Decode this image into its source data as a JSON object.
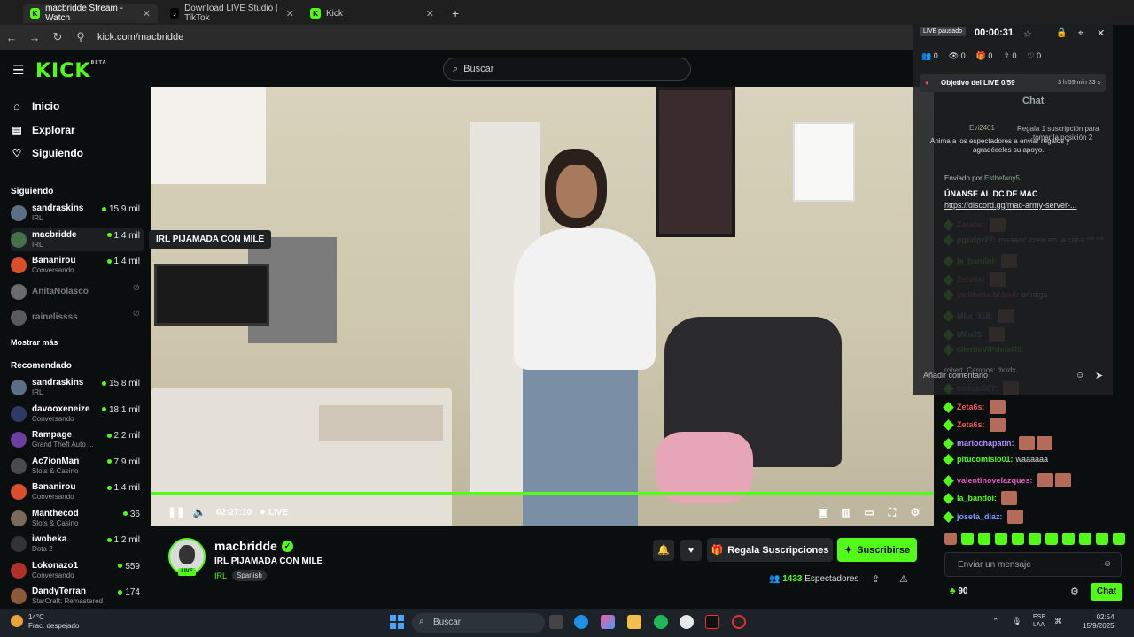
{
  "browser": {
    "tabs": [
      {
        "label": "macbridde Stream - Watch",
        "active": true
      },
      {
        "label": "Download LIVE Studio | TikTok",
        "active": false
      },
      {
        "label": "Kick",
        "active": false
      }
    ],
    "url": "kick.com/macbridde"
  },
  "header": {
    "logo": "KICK",
    "logo_badge": "BETA",
    "search_placeholder": "Buscar"
  },
  "sidebar": {
    "nav": [
      {
        "label": "Inicio",
        "icon": "home-icon"
      },
      {
        "label": "Explorar",
        "icon": "compass-icon"
      },
      {
        "label": "Siguiendo",
        "icon": "heart-icon"
      }
    ],
    "following_title": "Siguiendo",
    "following": [
      {
        "name": "sandraskins",
        "category": "IRL",
        "viewers": "15,9 mil",
        "live": true,
        "color": "#5b6f87"
      },
      {
        "name": "macbridde",
        "category": "IRL",
        "viewers": "1,4 mil",
        "live": true,
        "color": "#46704a"
      },
      {
        "name": "Bananirou",
        "category": "Conversando",
        "viewers": "1,4 mil",
        "live": true,
        "color": "#d94f2b"
      },
      {
        "name": "AnitaNolasco",
        "category": "",
        "viewers": "",
        "live": false,
        "color": "#6b6b6b"
      },
      {
        "name": "rainelissss",
        "category": "",
        "viewers": "",
        "live": false,
        "color": "#5a5a5a"
      }
    ],
    "show_more": "Mostrar más",
    "recommended_title": "Recomendado",
    "recommended": [
      {
        "name": "sandraskins",
        "category": "IRL",
        "viewers": "15,8 mil",
        "color": "#5b6f87"
      },
      {
        "name": "davooxeneize",
        "category": "Conversando",
        "viewers": "18,1 mil",
        "color": "#2d3a66"
      },
      {
        "name": "Rampage",
        "category": "Grand Theft Auto ...",
        "viewers": "2,2 mil",
        "color": "#6b3fa0"
      },
      {
        "name": "Ac7ionMan",
        "category": "Slots & Casino",
        "viewers": "7,9 mil",
        "color": "#4a4a4a"
      },
      {
        "name": "Bananirou",
        "category": "Conversando",
        "viewers": "1,4 mil",
        "color": "#d94f2b"
      },
      {
        "name": "Manthecod",
        "category": "Slots & Casino",
        "viewers": "36",
        "color": "#7a6a5a"
      },
      {
        "name": "iwobeka",
        "category": "Dota 2",
        "viewers": "1,2 mil",
        "color": "#333333"
      },
      {
        "name": "Lokonazo1",
        "category": "Conversando",
        "viewers": "559",
        "color": "#b0302a"
      },
      {
        "name": "DandyTerran",
        "category": "StarCraft: Remastered",
        "viewers": "174",
        "color": "#8a5a3a"
      }
    ],
    "tooltip": "IRL PIJAMADA CON MILE"
  },
  "player": {
    "time": "02:27:10",
    "live_label": "LIVE",
    "progress": 1.0
  },
  "stream": {
    "channel": "macbridde",
    "title": "IRL PIJAMADA CON MILE",
    "category": "IRL",
    "language": "Spanish",
    "live_badge": "LIVE",
    "gift_label": "Regala Suscripciones",
    "subscribe_label": "Suscribirse",
    "viewers_count": "1433",
    "viewers_label": "Espectadores"
  },
  "overlay": {
    "paused_badge": "LIVE pausado",
    "timer": "00:00:31",
    "stats": [
      "0",
      "0",
      "0",
      "0",
      "0"
    ],
    "goal_label": "Objetivo del LIVE 0/59",
    "goal_time": "3 h 59 min 33 s",
    "chat_title": "Chat",
    "gift_user": "Evi2401",
    "gift_msg": "Regala 1 suscripción para",
    "gift_msg2": "tomar la posición 2",
    "prompt1": "Anima a los espectadores a enviar regalos y",
    "prompt2": "agradéceles su apoyo.",
    "sent_by_label": "Enviado por",
    "sent_by_user": "Esthefany5",
    "pinned_text": "ÚNANSE AL DC DE MAC",
    "pinned_link": "https://discord.gg/mac-army-server-...",
    "comment_placeholder": "Añadir comentario",
    "ghost_line": "robert_Campos: dxxdx"
  },
  "chat": {
    "messages": [
      {
        "user": "Zeta6s",
        "text": "",
        "color": "#e55c5c",
        "emotes": 1
      },
      {
        "user": "pgodpr27",
        "text": "maaaac crew en la casa ^^ ^^",
        "color": "#c7c26a",
        "emotes": 0
      },
      {
        "user": "la_bandoi",
        "text": "",
        "color": "#53fc18",
        "emotes": 1
      },
      {
        "user": "Zeta6s",
        "text": "",
        "color": "#e55c5c",
        "emotes": 1
      },
      {
        "user": "yellibelia.brow4",
        "text": "omaiga",
        "color": "#e55c5c",
        "emotes": 0
      },
      {
        "user": "Mila_318",
        "text": "",
        "color": "#a779e0",
        "emotes": 1
      },
      {
        "user": "Milu25",
        "text": "",
        "color": "#6ec3a7",
        "emotes": 1
      },
      {
        "user": "clienteVIPdelaG5",
        "text": "",
        "color": "#53fc18",
        "emotes": 0
      },
      {
        "user": "bosvic907",
        "text": "",
        "color": "#7a7aff",
        "emotes": 1
      },
      {
        "user": "Zeta6s",
        "text": "",
        "color": "#e55c5c",
        "emotes": 1
      },
      {
        "user": "Zeta6s",
        "text": "",
        "color": "#e55c5c",
        "emotes": 1
      },
      {
        "user": "mariochapatin",
        "text": "",
        "color": "#b08cff",
        "emotes": 2
      },
      {
        "user": "pitucomisio01",
        "text": "waaaaaa",
        "color": "#53fc18",
        "emotes": 0
      },
      {
        "user": "valentinovelazques",
        "text": "",
        "color": "#e55cc0",
        "emotes": 2
      },
      {
        "user": "la_bandoi",
        "text": "",
        "color": "#53fc18",
        "emotes": 1
      },
      {
        "user": "josefa_diaz",
        "text": "",
        "color": "#7a9cff",
        "emotes": 1
      }
    ],
    "input_placeholder": "Enviar un mensaje",
    "points": "90",
    "chat_button": "Chat"
  },
  "taskbar": {
    "temperature": "14°C",
    "weather": "Frac. despejado",
    "search": "Buscar",
    "lang1": "ESP",
    "lang2": "LAA",
    "time": "02:54",
    "date": "15/9/2025"
  }
}
